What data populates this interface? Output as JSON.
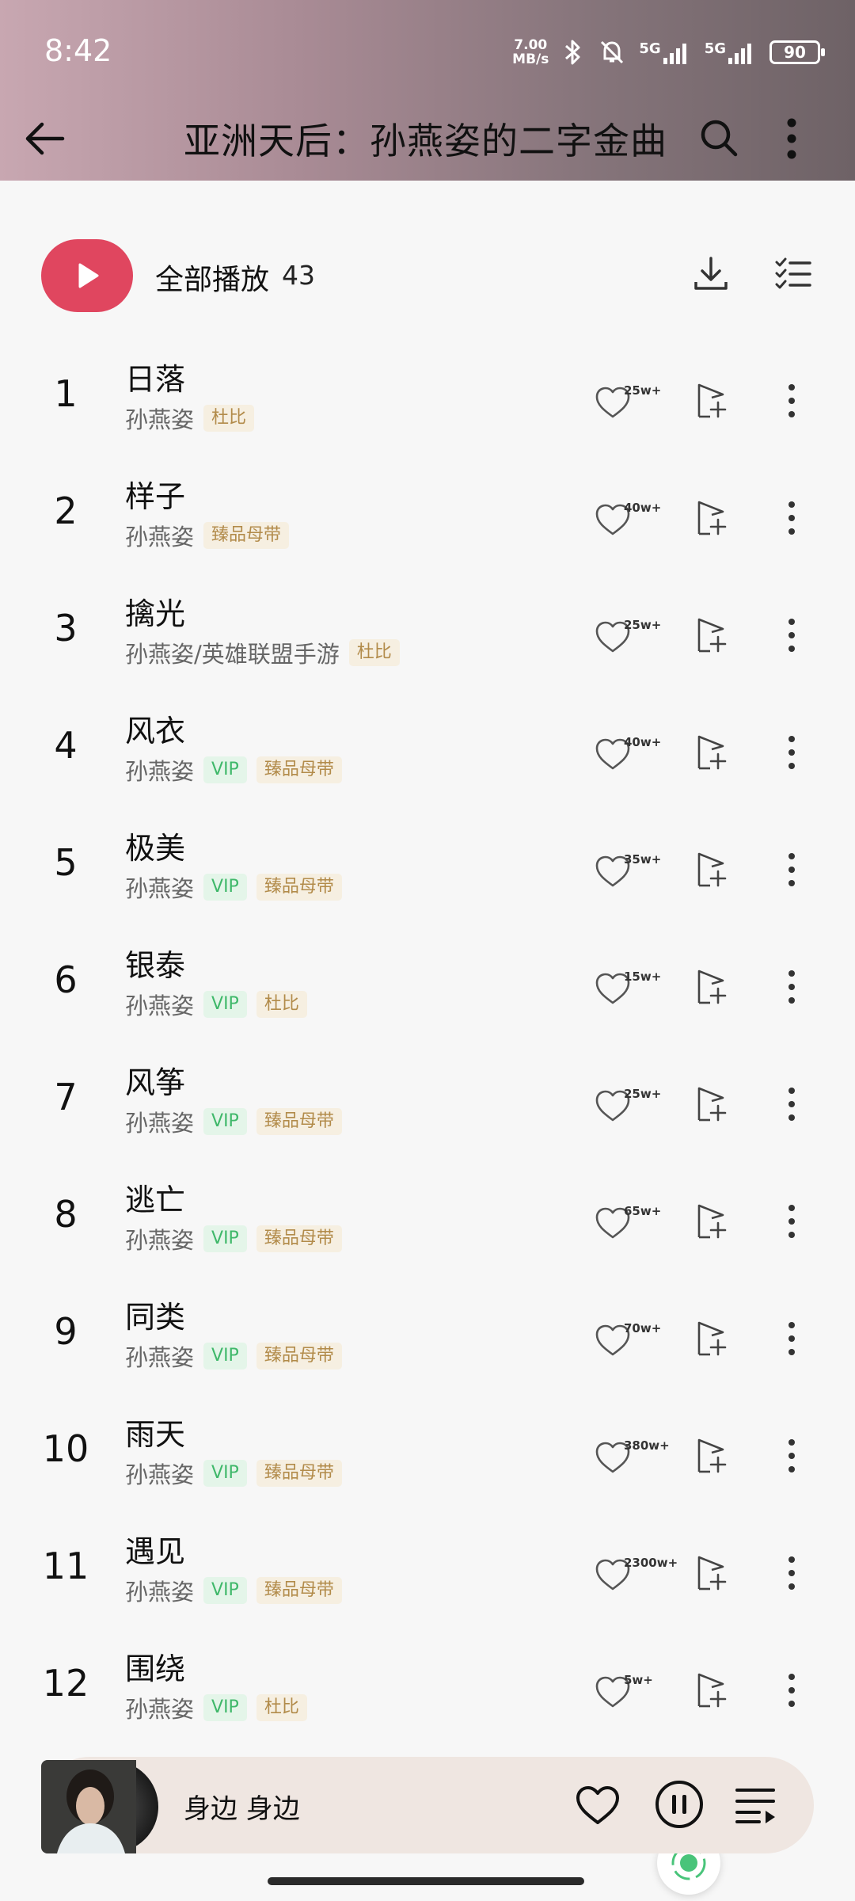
{
  "status_bar": {
    "time": "8:42",
    "speed_value": "7.00",
    "speed_unit": "MB/s",
    "network_1": "5G",
    "network_2": "5G",
    "battery": "90"
  },
  "header": {
    "title": "亚洲天后：孙燕姿的二字金曲",
    "back_icon": "arrow-left-icon",
    "search_icon": "search-icon",
    "more_icon": "more-vertical-icon"
  },
  "play_all": {
    "label": "全部播放",
    "count": "43"
  },
  "colors": {
    "accent": "#e0465f",
    "vip_text": "#3fb86a",
    "vip_bg": "#e4f5e9",
    "quality_text": "#b28b4a",
    "quality_bg": "#f6efe1"
  },
  "songs": [
    {
      "num": "1",
      "title": "日落",
      "artist": "孙燕姿",
      "vip": "",
      "quality": "杜比",
      "likes": "25w+"
    },
    {
      "num": "2",
      "title": "样子",
      "artist": "孙燕姿",
      "vip": "",
      "quality": "臻品母带",
      "likes": "40w+"
    },
    {
      "num": "3",
      "title": "擒光",
      "artist": "孙燕姿/英雄联盟手游",
      "vip": "",
      "quality": "杜比",
      "likes": "25w+"
    },
    {
      "num": "4",
      "title": "风衣",
      "artist": "孙燕姿",
      "vip": "VIP",
      "quality": "臻品母带",
      "likes": "40w+"
    },
    {
      "num": "5",
      "title": "极美",
      "artist": "孙燕姿",
      "vip": "VIP",
      "quality": "臻品母带",
      "likes": "35w+"
    },
    {
      "num": "6",
      "title": "银泰",
      "artist": "孙燕姿",
      "vip": "VIP",
      "quality": "杜比",
      "likes": "15w+"
    },
    {
      "num": "7",
      "title": "风筝",
      "artist": "孙燕姿",
      "vip": "VIP",
      "quality": "臻品母带",
      "likes": "25w+"
    },
    {
      "num": "8",
      "title": "逃亡",
      "artist": "孙燕姿",
      "vip": "VIP",
      "quality": "臻品母带",
      "likes": "65w+"
    },
    {
      "num": "9",
      "title": "同类",
      "artist": "孙燕姿",
      "vip": "VIP",
      "quality": "臻品母带",
      "likes": "70w+"
    },
    {
      "num": "10",
      "title": "雨天",
      "artist": "孙燕姿",
      "vip": "VIP",
      "quality": "臻品母带",
      "likes": "380w+"
    },
    {
      "num": "11",
      "title": "遇见",
      "artist": "孙燕姿",
      "vip": "VIP",
      "quality": "臻品母带",
      "likes": "2300w+"
    },
    {
      "num": "12",
      "title": "围绕",
      "artist": "孙燕姿",
      "vip": "VIP",
      "quality": "杜比",
      "likes": "5w+"
    }
  ],
  "player": {
    "now_playing": "身边 身边",
    "like_icon": "heart-icon",
    "pause_icon": "pause-icon",
    "queue_icon": "playlist-icon"
  }
}
